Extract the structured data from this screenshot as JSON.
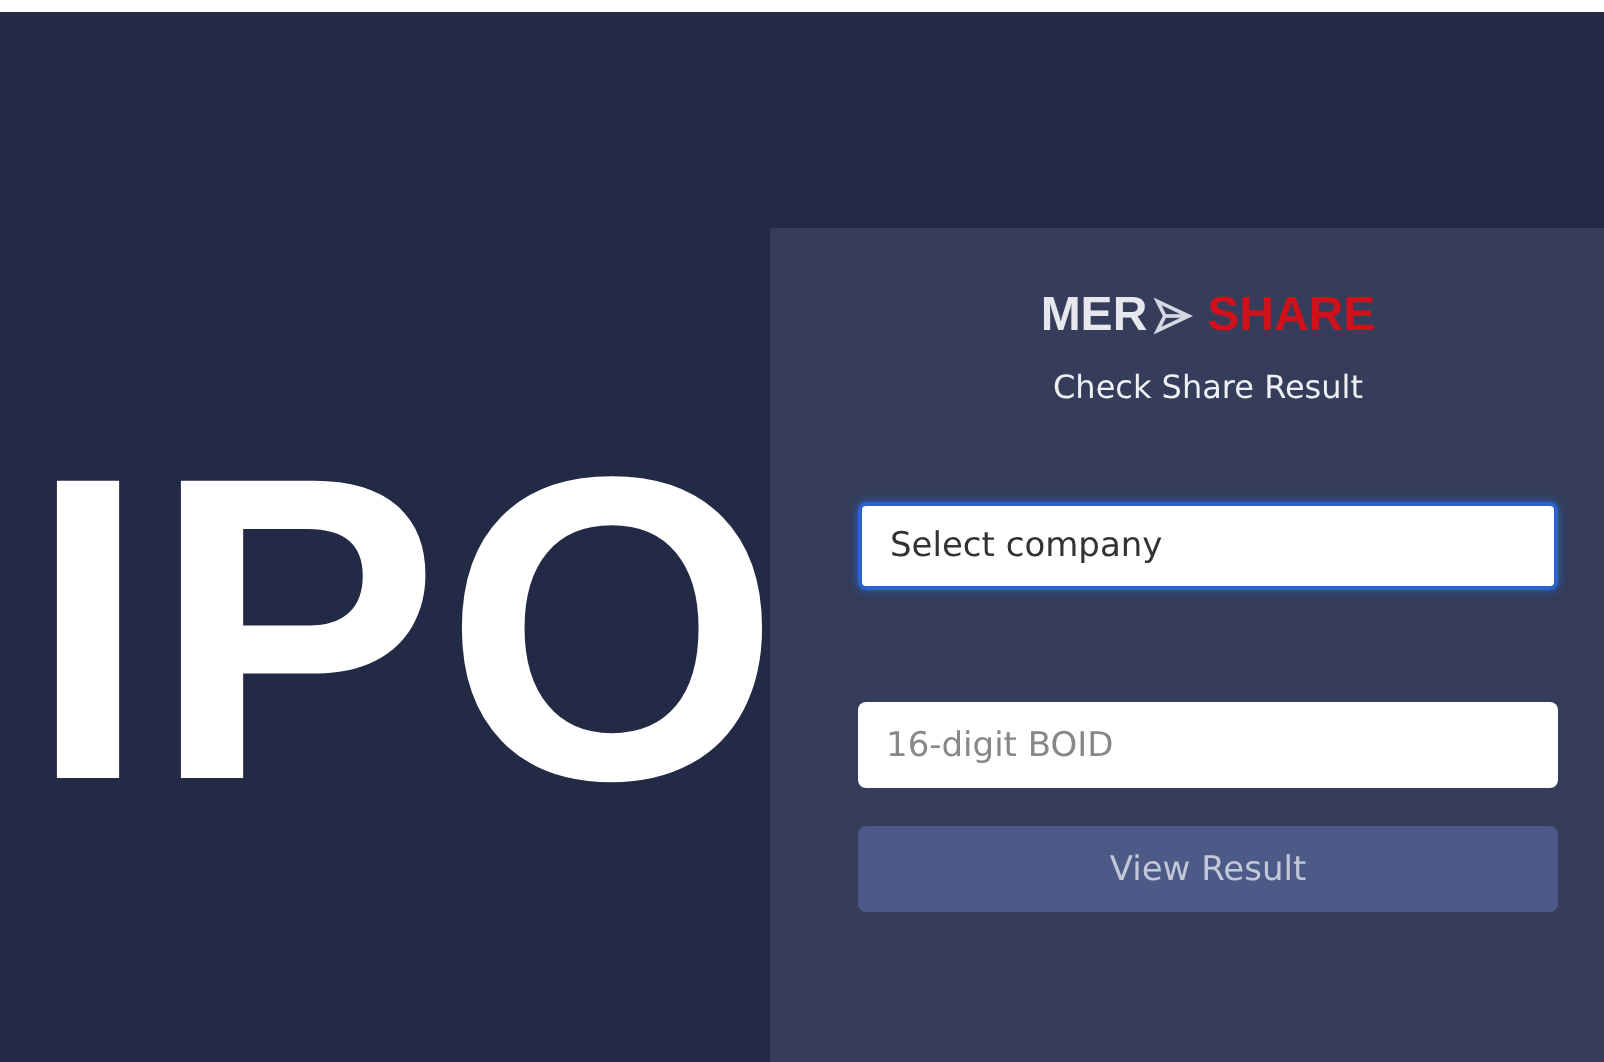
{
  "hero_text": "IPO",
  "logo": {
    "left": "MER",
    "right": "SHARE"
  },
  "subtitle": "Check Share Result",
  "company_select": {
    "value": "Select company",
    "focused": true
  },
  "boid_field": {
    "placeholder": "16-digit BOID"
  },
  "submit_button": {
    "label": "View Result",
    "disabled": true
  }
}
